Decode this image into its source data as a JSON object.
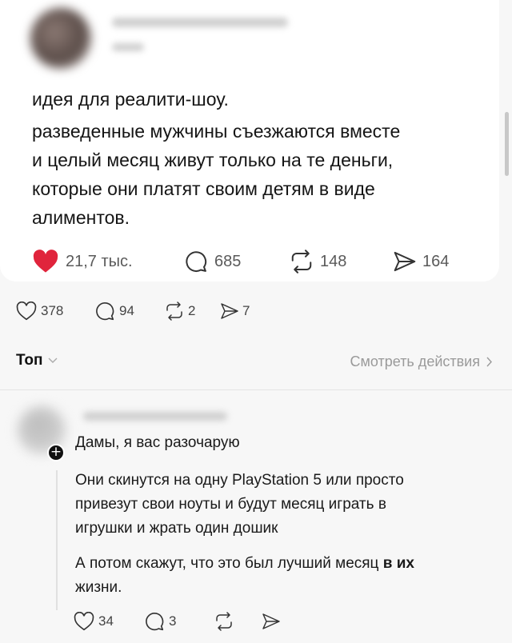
{
  "post": {
    "text_lines": [
      "идея для реалити-шоу.",
      "разведенные мужчины съезжаются вместе",
      "и целый месяц живут только на те деньги,",
      "которые они платят своим детям в виде",
      "алиментов."
    ],
    "likes": "21,7 тыс.",
    "comments": "685",
    "reposts": "148",
    "shares": "164"
  },
  "outer_stats": {
    "likes": "378",
    "comments": "94",
    "reposts": "2",
    "shares": "7"
  },
  "sort": {
    "label": "Топ",
    "view_activity": "Смотреть действия"
  },
  "reply": {
    "first_line": "Дамы, я вас разочарую",
    "para1_lines": [
      "Они скинутся на одну PlayStation 5 или просто",
      "привезут свои ноуты и будут месяц играть в",
      "игрушки и жрать один дошик"
    ],
    "para2_line1_prefix": "А потом скажут, что это был лучший месяц ",
    "para2_line1_bold": "в их",
    "para2_line2": "жизни.",
    "likes": "34",
    "comments": "3"
  },
  "icons": {
    "heart_filled": "heart-filled-icon",
    "heart": "heart-outline-icon",
    "comment": "comment-bubble-icon",
    "repost": "repost-icon",
    "share": "send-icon",
    "chevron": "chevron-icon"
  },
  "colors": {
    "like_red": "#e0243c",
    "muted": "#9a9a9a"
  }
}
